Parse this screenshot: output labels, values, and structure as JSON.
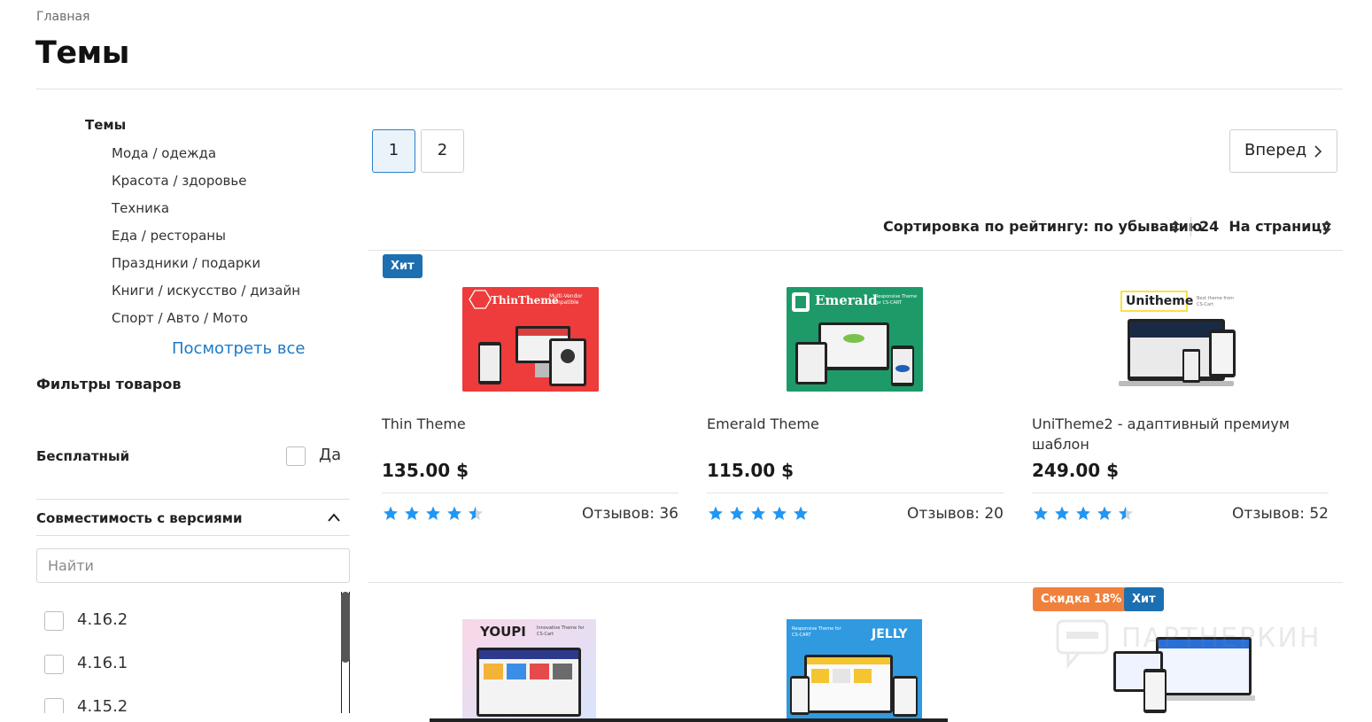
{
  "breadcrumb": "Главная",
  "page_title": "Темы",
  "categories": {
    "root": "Темы",
    "items": [
      "Мода / одежда",
      "Красота / здоровье",
      "Техника",
      "Еда / рестораны",
      "Праздники / подарки",
      "Книги / искусство / дизайн",
      "Спорт / Авто / Мото"
    ],
    "see_all": "Посмотреть все"
  },
  "filters": {
    "title": "Фильтры товаров",
    "free": {
      "label": "Бесплатный",
      "option": "Да",
      "checked": false
    },
    "compat": {
      "title": "Совместимость с версиями",
      "search_placeholder": "Найти",
      "versions": [
        "4.16.2",
        "4.16.1",
        "4.15.2"
      ]
    }
  },
  "pagination": {
    "pages": [
      "1",
      "2"
    ],
    "current": "1",
    "next_label": "Вперед"
  },
  "sort": {
    "label": "Сортировка по рейтингу: по убыванию",
    "per_page": "24  На страницу"
  },
  "products": [
    {
      "name": "Thin Theme",
      "price": "135.00 $",
      "rating": 4.5,
      "reviews": "Отзывов: 36",
      "badges": [
        "Хит"
      ]
    },
    {
      "name": "Emerald Theme",
      "price": "115.00 $",
      "rating": 5,
      "reviews": "Отзывов: 20",
      "badges": []
    },
    {
      "name": "UniTheme2 - адаптивный премиум шаблон",
      "price": "249.00 $",
      "rating": 4.5,
      "reviews": "Отзывов: 52",
      "badges": []
    }
  ],
  "next_row_badges": {
    "sale": "Скидка 18%",
    "hit": "Хит"
  },
  "thumbnails": {
    "thin": {
      "brand": "ThinTheme",
      "tagline": "Multi-Vendor compatible"
    },
    "emerald": {
      "brand": "Emerald",
      "tagline": "Responsive Theme for CS-CART"
    },
    "unitheme": {
      "brand": "Unitheme",
      "tagline": "Best theme from CS-Cart"
    },
    "youpi": {
      "brand": "YOUPI",
      "tagline": "Innovative Theme for CS-Cart"
    },
    "jelly": {
      "brand": "JELLY",
      "tagline": "Responsive Theme for CS-CART"
    }
  },
  "watermark": "ПАРТНЕРКИН",
  "colors": {
    "accent": "#1a7ac9",
    "hit_badge": "#1c6fb0",
    "sale_badge": "#f0813c",
    "star": "#2196f3"
  }
}
